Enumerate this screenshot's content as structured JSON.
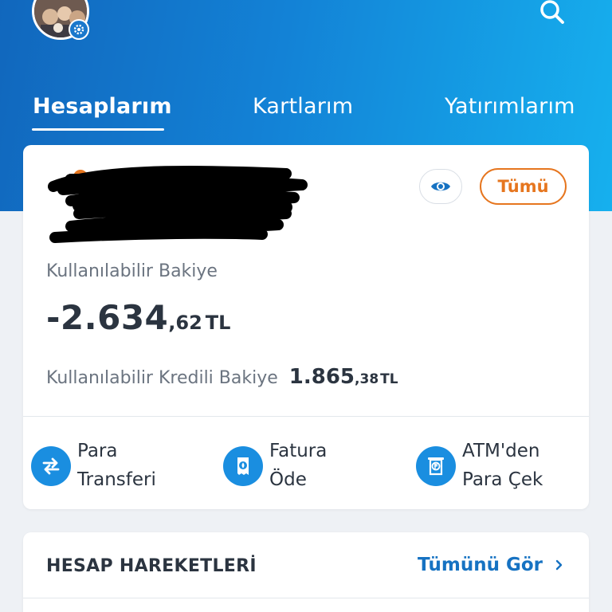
{
  "header": {
    "tabs": [
      {
        "label": "Hesaplarım",
        "active": true
      },
      {
        "label": "Kartlarım",
        "active": false
      },
      {
        "label": "Yatırımlarım",
        "active": false
      }
    ],
    "icons": {
      "search": "search-icon",
      "settings": "gear-icon"
    },
    "gradient_colors": [
      "#1167bd",
      "#16b0ee"
    ]
  },
  "account": {
    "eye_icon": "eye-icon",
    "all_button_label": "Tümü",
    "balance_label": "Kullanılabilir Bakiye",
    "balance_integer": "-2.634",
    "balance_decimal": ",62",
    "balance_currency": "TL",
    "credit_label": "Kullanılabilir Kredili Bakiye",
    "credit_integer": "1.865",
    "credit_decimal": ",38",
    "credit_currency": "TL",
    "accent_color": "#e6761f"
  },
  "actions": [
    {
      "icon": "transfer-icon",
      "line1": "Para",
      "line2": "Transferi"
    },
    {
      "icon": "bill-icon",
      "line1": "Fatura",
      "line2": "Öde"
    },
    {
      "icon": "atm-icon",
      "line1": "ATM'den",
      "line2": "Para Çek"
    }
  ],
  "movements": {
    "title": "HESAP HAREKETLERİ",
    "see_all_label": "Tümünü Gör",
    "link_color": "#1672c2"
  }
}
